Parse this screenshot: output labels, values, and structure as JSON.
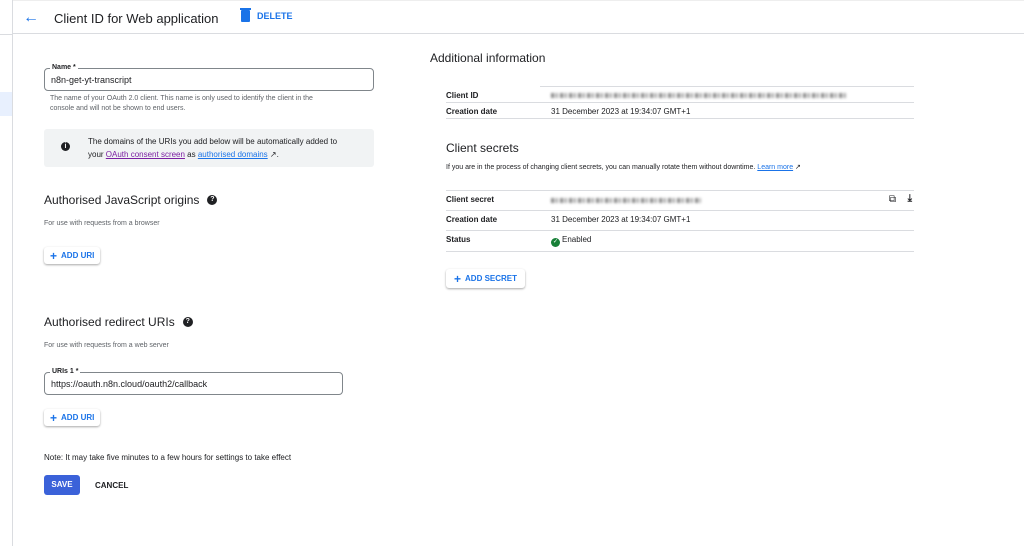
{
  "header": {
    "title": "Client ID for Web application",
    "delete_label": "DELETE"
  },
  "form": {
    "name_label": "Name *",
    "name_value": "n8n-get-yt-transcript",
    "name_hint_1": "The name of your OAuth 2.0 client. This name is only used to identify the client in the",
    "name_hint_2": "console and will not be shown to end users.",
    "info_text_1": "The domains of the URIs you add below will be automatically added to",
    "info_text_2a": "your ",
    "info_link_1": "OAuth consent screen",
    "info_text_2b": " as ",
    "info_link_2": "authorised domains",
    "info_text_2c": ".",
    "js_origins_title": "Authorised JavaScript origins",
    "js_origins_hint": "For use with requests from a browser",
    "add_uri_label": "ADD URI",
    "redirect_title": "Authorised redirect URIs",
    "redirect_hint": "For use with requests from a web server",
    "uri_label": "URIs 1 *",
    "uri_value": "https://oauth.n8n.cloud/oauth2/callback",
    "note": "Note: It may take five minutes to a few hours for settings to take effect",
    "save_label": "SAVE",
    "cancel_label": "CANCEL"
  },
  "additional": {
    "title": "Additional information",
    "client_id_label": "Client ID",
    "creation_label": "Creation date",
    "creation_value": "31 December 2023 at 19:34:07 GMT+1",
    "secrets_title": "Client secrets",
    "secrets_desc": "If you are in the process of changing client secrets, you can manually rotate them without downtime.",
    "learn_more": "Learn more",
    "secret_label": "Client secret",
    "secret_creation_label": "Creation date",
    "secret_creation_value": "31 December 2023 at 19:34:07 GMT+1",
    "status_label": "Status",
    "status_value": "Enabled",
    "add_secret_label": "ADD SECRET"
  },
  "colors": {
    "accent": "#1a73e8",
    "save": "#3b62d9",
    "enabled": "#188038"
  }
}
